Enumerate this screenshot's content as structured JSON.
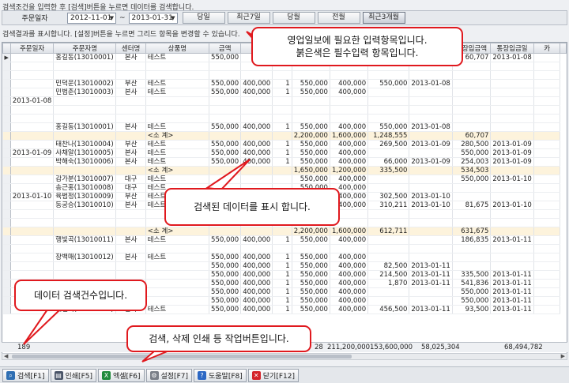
{
  "info_line_top": "검색조건을 입력한 후 [검색]버튼을 누르면 데이터를 검색합니다.",
  "filter": {
    "label": "주문일자",
    "date_from": "2012-11-01",
    "tilde": "~",
    "date_to": "2013-01-31",
    "buttons": [
      "당일",
      "최근7일",
      "당월",
      "전월",
      "최근3개월"
    ]
  },
  "info_line_grid": "검색결과를 표시합니다. [설정]버튼을 누르면 그리드 항목을 변경할 수 있습니다.",
  "grid": {
    "headers": [
      "주문일자",
      "주문자명",
      "센터명",
      "상품명",
      "금액",
      "",
      "",
      "",
      "",
      "",
      "",
      "통장입금액",
      "통장입금일",
      "카"
    ],
    "rows": [
      {
        "date": "",
        "name": "홍길동(13010001)",
        "center": "본사",
        "product": "테스트",
        "c5": "550,000",
        "c6": "",
        "c7": "",
        "c8": "",
        "c9": "",
        "c10": "",
        "c11": "",
        "bank_amt": "60,707",
        "bank_date": "2013-01-08",
        "marker": "▶"
      },
      {
        "date": "",
        "name": "",
        "center": "",
        "product": "",
        "c5": "",
        "c6": "",
        "c7": "",
        "c8": "",
        "c9": "",
        "c10": "",
        "c11": "",
        "bank_amt": "",
        "bank_date": ""
      },
      {
        "date": "",
        "name": "",
        "center": "",
        "product": "",
        "c5": "",
        "c6": "",
        "c7": "",
        "c8": "",
        "c9": "",
        "c10": "",
        "c11": "",
        "bank_amt": "",
        "bank_date": ""
      },
      {
        "date": "",
        "name": "민덕운(13010002)",
        "center": "부산",
        "product": "테스트",
        "c5": "550,000",
        "c6": "400,000",
        "c7": "1",
        "c8": "550,000",
        "c9": "400,000",
        "c10": "550,000",
        "c11": "2013-01-08",
        "bank_amt": "",
        "bank_date": ""
      },
      {
        "date": "",
        "name": "민범춘(13010003)",
        "center": "본사",
        "product": "테스트",
        "c5": "550,000",
        "c6": "400,000",
        "c7": "1",
        "c8": "550,000",
        "c9": "400,000",
        "c10": "",
        "c11": "",
        "bank_amt": "",
        "bank_date": ""
      },
      {
        "date": "2013-01-08",
        "name": "",
        "center": "",
        "product": "",
        "c5": "",
        "c6": "",
        "c7": "",
        "c8": "",
        "c9": "",
        "c10": "",
        "c11": "",
        "bank_amt": "",
        "bank_date": ""
      },
      {
        "date": "",
        "name": "",
        "center": "",
        "product": "",
        "c5": "",
        "c6": "",
        "c7": "",
        "c8": "",
        "c9": "",
        "c10": "",
        "c11": "",
        "bank_amt": "",
        "bank_date": ""
      },
      {
        "date": "",
        "name": "",
        "center": "",
        "product": "",
        "c5": "",
        "c6": "",
        "c7": "",
        "c8": "",
        "c9": "",
        "c10": "",
        "c11": "",
        "bank_amt": "",
        "bank_date": ""
      },
      {
        "date": "",
        "name": "홍길동(13010001)",
        "center": "본사",
        "product": "테스트",
        "c5": "550,000",
        "c6": "400,000",
        "c7": "1",
        "c8": "550,000",
        "c9": "400,000",
        "c10": "550,000",
        "c11": "2013-01-08",
        "bank_amt": "",
        "bank_date": ""
      },
      {
        "date": "",
        "name": "",
        "center": "",
        "product": "<소 계>",
        "c5": "",
        "c6": "",
        "c7": "",
        "c8": "2,200,000",
        "c9": "1,600,000",
        "c10": "1,248,555",
        "c11": "",
        "bank_amt": "60,707",
        "bank_date": "",
        "sub": true
      },
      {
        "date": "",
        "name": "태찬나(13010004)",
        "center": "부산",
        "product": "테스트",
        "c5": "550,000",
        "c6": "400,000",
        "c7": "1",
        "c8": "550,000",
        "c9": "400,000",
        "c10": "269,500",
        "c11": "2013-01-09",
        "bank_amt": "280,500",
        "bank_date": "2013-01-09"
      },
      {
        "date": "2013-01-09",
        "name": "사채알(13010005)",
        "center": "본사",
        "product": "테스트",
        "c5": "550,000",
        "c6": "400,000",
        "c7": "1",
        "c8": "550,000",
        "c9": "400,000",
        "c10": "",
        "c11": "",
        "bank_amt": "550,000",
        "bank_date": "2013-01-09"
      },
      {
        "date": "",
        "name": "박해숙(13010006)",
        "center": "본사",
        "product": "테스트",
        "c5": "550,000",
        "c6": "400,000",
        "c7": "1",
        "c8": "550,000",
        "c9": "400,000",
        "c10": "66,000",
        "c11": "2013-01-09",
        "bank_amt": "254,003",
        "bank_date": "2013-01-09"
      },
      {
        "date": "",
        "name": "",
        "center": "",
        "product": "<소 계>",
        "c5": "",
        "c6": "",
        "c7": "",
        "c8": "1,650,000",
        "c9": "1,200,000",
        "c10": "335,500",
        "c11": "",
        "bank_amt": "534,503",
        "bank_date": "",
        "sub": true
      },
      {
        "date": "",
        "name": "감가분(13010007)",
        "center": "대구",
        "product": "테스트",
        "c5": "",
        "c6": "",
        "c7": "",
        "c8": "550,000",
        "c9": "400,000",
        "c10": "",
        "c11": "",
        "bank_amt": "550,000",
        "bank_date": "2013-01-10"
      },
      {
        "date": "",
        "name": "송근홍(13010008)",
        "center": "대구",
        "product": "테스트",
        "c5": "",
        "c6": "",
        "c7": "",
        "c8": "550,000",
        "c9": "400,000",
        "c10": "",
        "c11": "",
        "bank_amt": "",
        "bank_date": ""
      },
      {
        "date": "2013-01-10",
        "name": "육범정(13010009)",
        "center": "부산",
        "product": "테스트",
        "c5": "",
        "c6": "",
        "c7": "",
        "c8": "550,000",
        "c9": "400,000",
        "c10": "302,500",
        "c11": "2013-01-10",
        "bank_amt": "",
        "bank_date": ""
      },
      {
        "date": "",
        "name": "동궁승(13010010)",
        "center": "본사",
        "product": "테스트",
        "c5": "",
        "c6": "",
        "c7": "",
        "c8": "550,000",
        "c9": "400,000",
        "c10": "310,211",
        "c11": "2013-01-10",
        "bank_amt": "81,675",
        "bank_date": "2013-01-10"
      },
      {
        "date": "",
        "name": "",
        "center": "",
        "product": "",
        "c5": "",
        "c6": "",
        "c7": "",
        "c8": "",
        "c9": "",
        "c10": "",
        "c11": "",
        "bank_amt": "",
        "bank_date": ""
      },
      {
        "date": "",
        "name": "",
        "center": "",
        "product": "",
        "c5": "",
        "c6": "",
        "c7": "",
        "c8": "",
        "c9": "",
        "c10": "",
        "c11": "",
        "bank_amt": "",
        "bank_date": ""
      },
      {
        "date": "",
        "name": "",
        "center": "",
        "product": "<소 계>",
        "c5": "",
        "c6": "",
        "c7": "",
        "c8": "2,200,000",
        "c9": "1,600,000",
        "c10": "612,711",
        "c11": "",
        "bank_amt": "631,675",
        "bank_date": "",
        "sub": true
      },
      {
        "date": "",
        "name": "행빛곡(13010011)",
        "center": "본사",
        "product": "테스트",
        "c5": "550,000",
        "c6": "400,000",
        "c7": "1",
        "c8": "550,000",
        "c9": "400,000",
        "c10": "",
        "c11": "",
        "bank_amt": "186,835",
        "bank_date": "2013-01-11"
      },
      {
        "date": "",
        "name": "",
        "center": "",
        "product": "",
        "c5": "",
        "c6": "",
        "c7": "",
        "c8": "",
        "c9": "",
        "c10": "",
        "c11": "",
        "bank_amt": "",
        "bank_date": ""
      },
      {
        "date": "",
        "name": "장백매(13010012)",
        "center": "본사",
        "product": "테스트",
        "c5": "550,000",
        "c6": "400,000",
        "c7": "1",
        "c8": "550,000",
        "c9": "400,000",
        "c10": "",
        "c11": "",
        "bank_amt": "",
        "bank_date": ""
      },
      {
        "date": "",
        "name": "",
        "center": "",
        "product": "",
        "c5": "550,000",
        "c6": "400,000",
        "c7": "1",
        "c8": "550,000",
        "c9": "400,000",
        "c10": "82,500",
        "c11": "2013-01-11",
        "bank_amt": "",
        "bank_date": ""
      },
      {
        "date": "",
        "name": "",
        "center": "",
        "product": "",
        "c5": "550,000",
        "c6": "400,000",
        "c7": "1",
        "c8": "550,000",
        "c9": "400,000",
        "c10": "214,500",
        "c11": "2013-01-11",
        "bank_amt": "335,500",
        "bank_date": "2013-01-11"
      },
      {
        "date": "",
        "name": "",
        "center": "",
        "product": "",
        "c5": "550,000",
        "c6": "400,000",
        "c7": "1",
        "c8": "550,000",
        "c9": "400,000",
        "c10": "1,870",
        "c11": "2013-01-11",
        "bank_amt": "541,836",
        "bank_date": "2013-01-11"
      },
      {
        "date": "",
        "name": "",
        "center": "",
        "product": "",
        "c5": "550,000",
        "c6": "400,000",
        "c7": "1",
        "c8": "550,000",
        "c9": "400,000",
        "c10": "",
        "c11": "",
        "bank_amt": "550,000",
        "bank_date": "2013-01-11"
      },
      {
        "date": "",
        "name": "",
        "center": "",
        "product": "",
        "c5": "550,000",
        "c6": "400,000",
        "c7": "1",
        "c8": "550,000",
        "c9": "400,000",
        "c10": "",
        "c11": "",
        "bank_amt": "550,000",
        "bank_date": "2013-01-11"
      },
      {
        "date": "",
        "name": "태별익(13010015)",
        "center": "본사",
        "product": "테스트",
        "c5": "550,000",
        "c6": "400,000",
        "c7": "1",
        "c8": "550,000",
        "c9": "400,000",
        "c10": "456,500",
        "c11": "2013-01-11",
        "bank_amt": "93,500",
        "bank_date": "2013-01-11"
      }
    ],
    "summary": {
      "row_count": "189",
      "qty": "28",
      "amt1": "211,200,000",
      "amt2": "153,600,000",
      "amt3": "58,025,304",
      "bank": "68,494,782"
    }
  },
  "toolbar": [
    {
      "label": "검색[F1]",
      "icon": "search-icon",
      "color": "#2f6fb3"
    },
    {
      "label": "인쇄[F5]",
      "icon": "print-icon",
      "color": "#4a5568"
    },
    {
      "label": "엑셀[F6]",
      "icon": "excel-icon",
      "color": "#1f8a3b"
    },
    {
      "label": "설정[F7]",
      "icon": "gear-icon",
      "color": "#7a7f88"
    },
    {
      "label": "도움말[F8]",
      "icon": "help-icon",
      "color": "#2c68c4"
    },
    {
      "label": "닫기[F12]",
      "icon": "close-icon",
      "color": "#d4242a"
    }
  ],
  "callouts": {
    "top_line1": "영업일보에 필요한 입력항목입니다.",
    "top_line2": "붉은색은 필수입력 항목입니다.",
    "middle": "검색된 데이터를 표시 합니다.",
    "count": "데이터 검색건수입니다.",
    "buttons": "검색, 삭제 인쇄 등 작업버튼입니다."
  }
}
